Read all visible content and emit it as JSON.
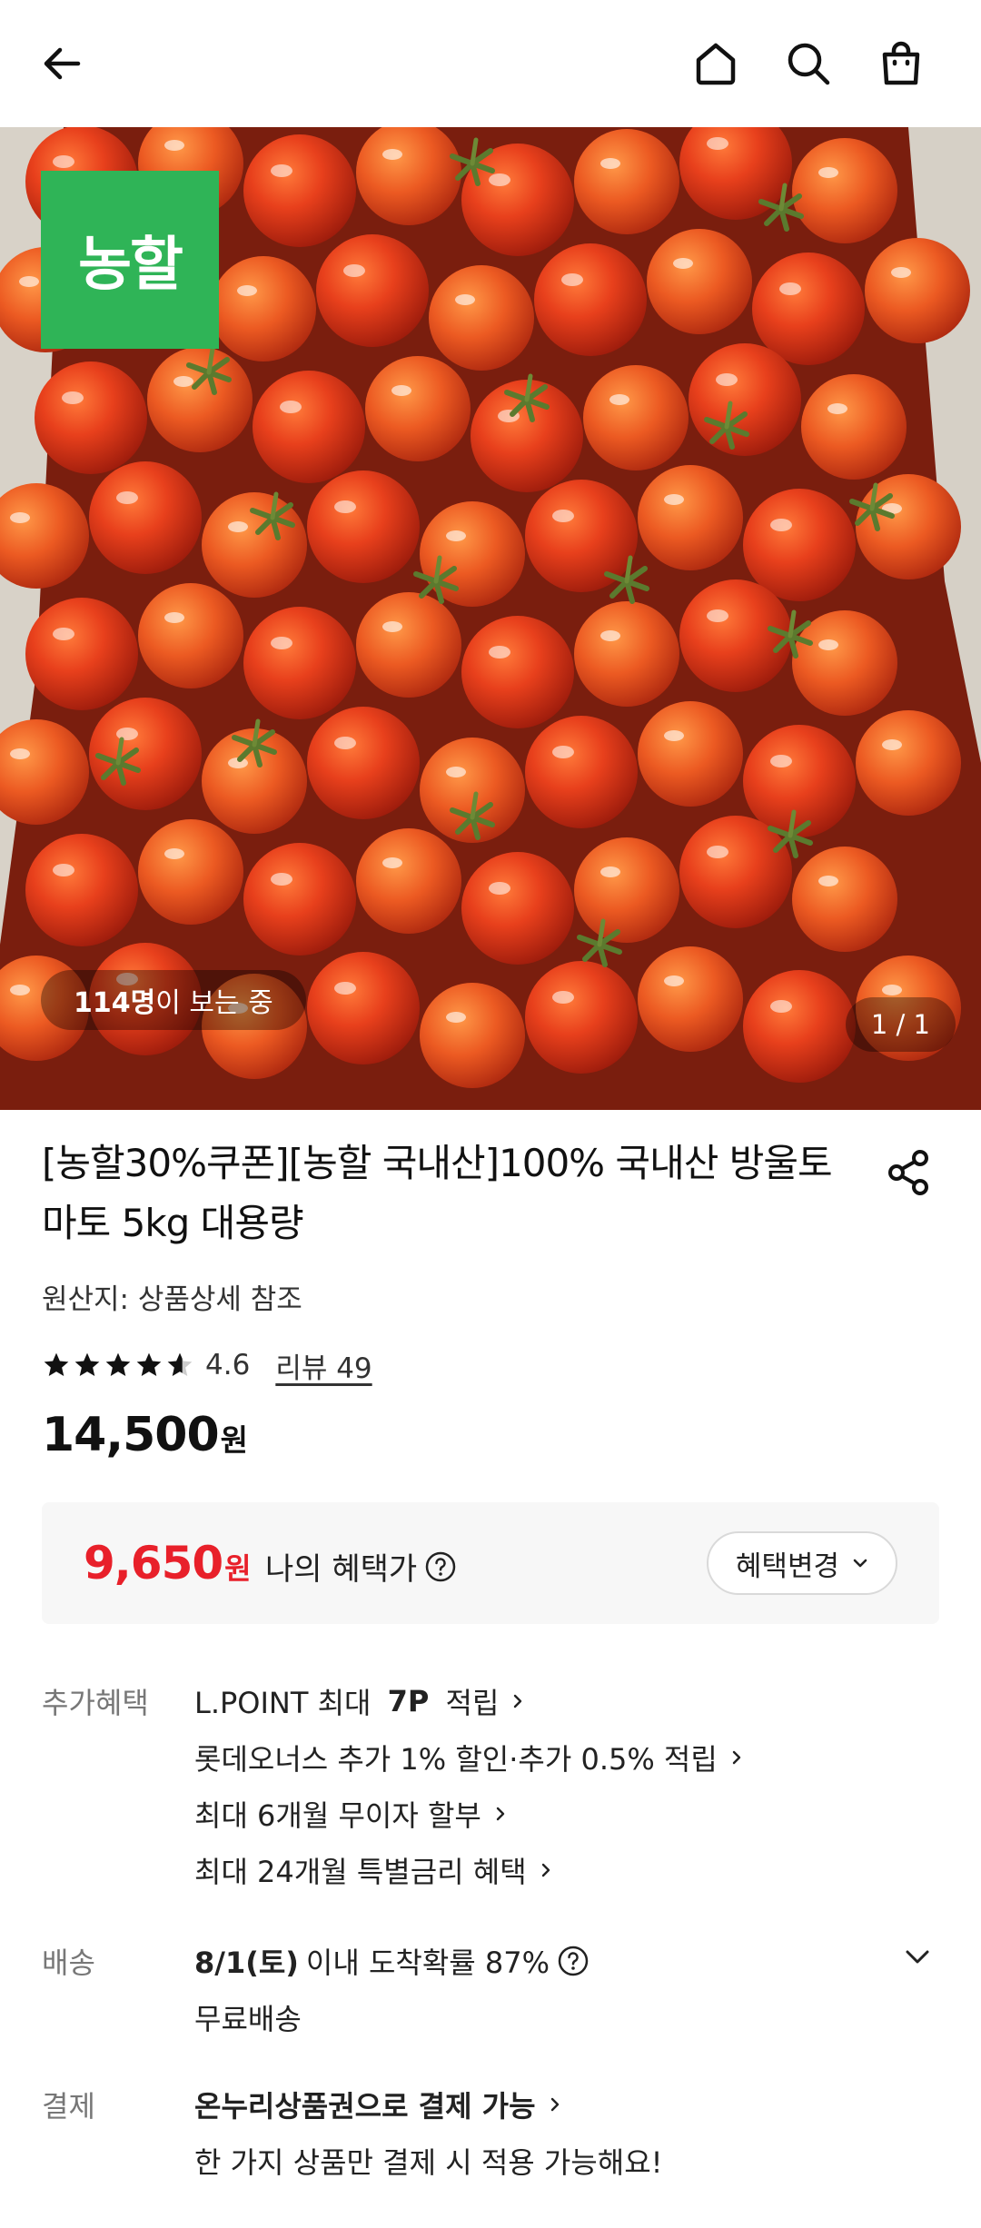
{
  "header": {
    "back_icon": "back-arrow-icon",
    "home_icon": "home-icon",
    "search_icon": "search-icon",
    "cart_icon": "shopping-bag-icon"
  },
  "hero": {
    "brand_badge": "농할",
    "viewers_count": "114명",
    "viewers_suffix": "이 보는 중",
    "page_indicator": "1 / 1"
  },
  "product": {
    "title": "[농할30%쿠폰][농할 국내산]100% 국내산 방울토마토 5kg 대용량",
    "origin": "원산지: 상품상세 참조",
    "rating": 4.6,
    "rating_text": "4.6",
    "review_link": "리뷰 49",
    "price": "14,500",
    "price_unit": "원"
  },
  "benefit": {
    "price": "9,650",
    "unit": "원",
    "label": "나의 혜택가",
    "change_button": "혜택변경"
  },
  "extra_benefits": {
    "label": "추가혜택",
    "line1_pre": "L.POINT 최대 ",
    "line1_bold": "7P",
    "line1_post": " 적립",
    "line2": "롯데오너스 추가 1% 할인·추가 0.5% 적립",
    "line3": "최대 6개월 무이자 할부",
    "line4": "최대 24개월 특별금리 혜택"
  },
  "delivery": {
    "label": "배송",
    "date_bold": "8/1(토)",
    "date_rest": "이내 도착확률 87%",
    "fee": "무료배송"
  },
  "payment": {
    "label": "결제",
    "line1": "온누리상품권으로 결제 가능",
    "line2": "한 가지 상품만 결제 시 적용 가능해요!"
  },
  "colors": {
    "brand_green": "#2fb457",
    "benefit_red": "#e8202a"
  }
}
